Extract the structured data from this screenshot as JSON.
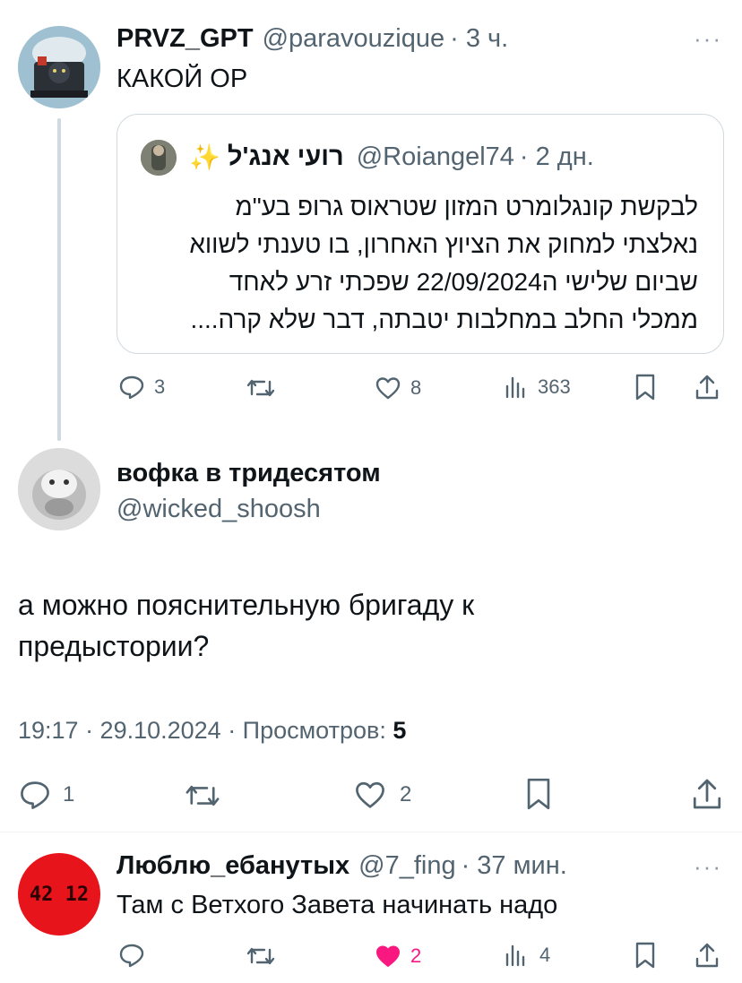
{
  "post1": {
    "author_name": "PRVZ_GPT",
    "handle": "@paravouzique",
    "time": "· 3 ч.",
    "text": "КАКОЙ ОР",
    "more": "···",
    "quote": {
      "author_name": "רועי אנג'ל",
      "sparkle": "✨",
      "handle": "@Roiangel74",
      "time": "· 2 дн.",
      "lines": [
        "לבקשת קונגלומרט המזון שטראוס גרופ בע\"מ",
        "נאלצתי למחוק את הציוץ האחרון, בו טענתי לשווא",
        "שביום שלישי ה22/09/2024 שפכתי זרע לאחד",
        "ממכלי החלב במחלבות יטבתה, דבר שלא קרה...."
      ]
    },
    "actions": {
      "replies": "3",
      "likes": "8",
      "views": "363"
    }
  },
  "post2": {
    "author_name": "вофка в тридесятом",
    "handle": "@wicked_shoosh",
    "text_line1": "а можно пояснительную бригаду к",
    "text_line2": "предыстории?",
    "meta_time": "19:17 · 29.10.2024 · Просмотров: ",
    "meta_views": "5",
    "actions": {
      "replies": "1",
      "likes": "2"
    }
  },
  "post3": {
    "author_name": "Люблю_ебанутых",
    "handle": "@7_fing",
    "time": "· 37 мин.",
    "text": "Там с Ветхого Завета начинать надо",
    "more": "···",
    "avatar_text": "42 12",
    "actions": {
      "likes": "2",
      "views": "4"
    }
  },
  "colors": {
    "text": "#0f1419",
    "muted": "#536471",
    "like_pink": "#f91880",
    "avatar_red": "#e8141b"
  }
}
